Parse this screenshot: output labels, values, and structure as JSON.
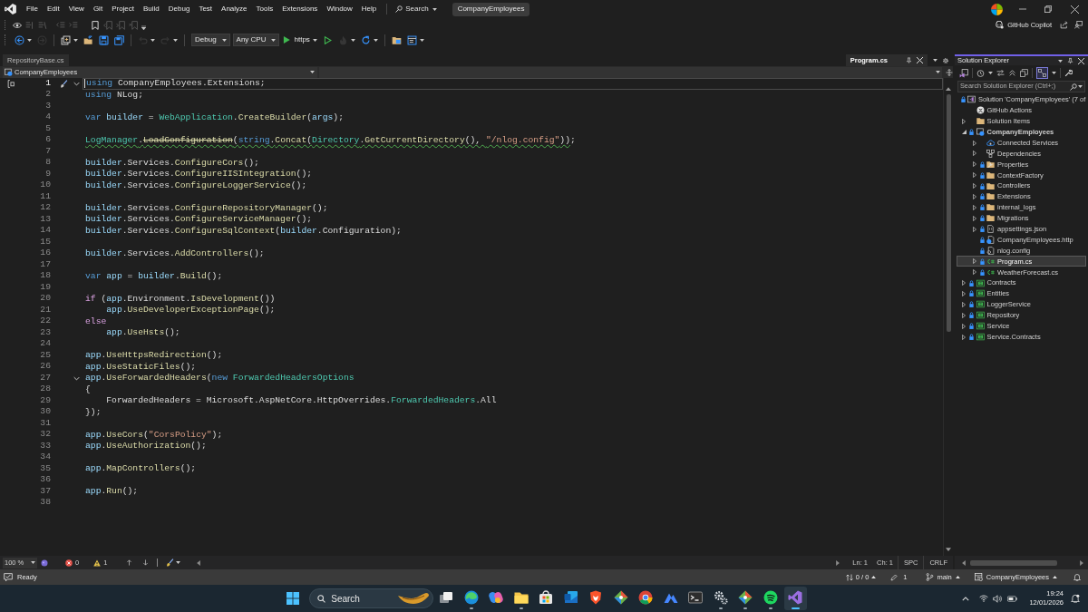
{
  "title_bar": {
    "menu": [
      "File",
      "Edit",
      "View",
      "Git",
      "Project",
      "Build",
      "Debug",
      "Test",
      "Analyze",
      "Tools",
      "Extensions",
      "Window",
      "Help"
    ],
    "search": "Search",
    "solution_name": "CompanyEmployees"
  },
  "edit_toolbar": [
    {
      "kind": "codelens",
      "disabled": false
    },
    {
      "kind": "comment",
      "disabled": true
    },
    {
      "kind": "uncomment",
      "disabled": true
    },
    {
      "kind": "outdent",
      "disabled": true
    },
    {
      "kind": "indent",
      "disabled": true
    },
    {
      "kind": "bookmark",
      "disabled": false
    },
    {
      "kind": "bookmark-prev",
      "disabled": true
    },
    {
      "kind": "bookmark-next",
      "disabled": true
    },
    {
      "kind": "bookmark-clear",
      "disabled": true
    }
  ],
  "copilot": {
    "label": "GitHub Copilot"
  },
  "toolbar": [
    {
      "kind": "back",
      "disabled": false,
      "menu": true
    },
    {
      "kind": "forward",
      "disabled": true,
      "menu": false
    },
    {
      "kind": "separator"
    },
    {
      "kind": "new-item",
      "disabled": false,
      "menu": true
    },
    {
      "kind": "open",
      "disabled": false,
      "menu": false
    },
    {
      "kind": "save",
      "disabled": false,
      "menu": false
    },
    {
      "kind": "save-all",
      "disabled": false,
      "menu": false
    },
    {
      "kind": "separator"
    },
    {
      "kind": "undo",
      "disabled": true,
      "menu": true
    },
    {
      "kind": "redo",
      "disabled": true,
      "menu": true
    },
    {
      "kind": "separator"
    },
    {
      "kind": "dropdown",
      "value": "Debug"
    },
    {
      "kind": "dropdown",
      "value": "Any CPU"
    },
    {
      "kind": "start",
      "label": "https",
      "disabled": false,
      "menu": true
    },
    {
      "kind": "start-outline",
      "disabled": false,
      "menu": false
    },
    {
      "kind": "hot-reload",
      "disabled": true,
      "menu": true
    },
    {
      "kind": "restart",
      "disabled": false,
      "menu": true
    },
    {
      "kind": "separator"
    },
    {
      "kind": "solution-view",
      "disabled": false,
      "menu": false
    },
    {
      "kind": "window-layout",
      "disabled": false,
      "menu": true
    }
  ],
  "editor": {
    "pinned_tabs": [
      {
        "label": "RepositoryBase.cs",
        "selected": false
      }
    ],
    "tabs": [
      {
        "label": "Program.cs",
        "selected": true
      }
    ],
    "navigation": {
      "project": "CompanyEmployees"
    },
    "lines": [
      {
        "number": "1",
        "current": true,
        "foldable": true,
        "tokens": [
          {
            "text": "using",
            "kind": "keyword"
          },
          {
            "text": " CompanyEmployees.Extensions;",
            "kind": "plain"
          }
        ]
      },
      {
        "number": "2",
        "current": false,
        "tokens": [
          {
            "text": "using",
            "kind": "keyword"
          },
          {
            "text": " NLog;",
            "kind": "plain"
          }
        ]
      },
      {
        "number": "3",
        "current": false
      },
      {
        "number": "4",
        "current": false,
        "tokens": [
          {
            "text": "var",
            "kind": "keyword"
          },
          {
            "text": " builder",
            "kind": "variable"
          },
          {
            "text": " = ",
            "kind": "plain"
          },
          {
            "text": "WebApplication",
            "kind": "type"
          },
          {
            "text": ".",
            "kind": "plain"
          },
          {
            "text": "CreateBuilder",
            "kind": "method"
          },
          {
            "text": "(",
            "kind": "plain"
          },
          {
            "text": "args",
            "kind": "variable"
          },
          {
            "text": ");",
            "kind": "plain"
          }
        ]
      },
      {
        "number": "5",
        "current": false
      },
      {
        "number": "6",
        "current": false,
        "tokens": [
          {
            "kind": "warning",
            "tokens": [
              {
                "text": "LogManager",
                "kind": "type"
              },
              {
                "text": ".",
                "kind": "plain"
              },
              {
                "text": "LoadConfiguration",
                "kind": "obsolete"
              },
              {
                "text": "(",
                "kind": "plain"
              },
              {
                "text": "string",
                "kind": "keyword"
              },
              {
                "text": ".",
                "kind": "plain"
              },
              {
                "text": "Concat",
                "kind": "method"
              },
              {
                "text": "(",
                "kind": "plain"
              },
              {
                "text": "Directory",
                "kind": "type"
              },
              {
                "text": ".",
                "kind": "plain"
              },
              {
                "text": "GetCurrentDirectory",
                "kind": "method"
              },
              {
                "text": "(), ",
                "kind": "plain"
              },
              {
                "text": "\"/nlog.config\"",
                "kind": "string"
              },
              {
                "text": "))",
                "kind": "plain"
              }
            ]
          },
          {
            "text": ";",
            "kind": "plain"
          }
        ]
      },
      {
        "number": "7",
        "current": false
      },
      {
        "number": "8",
        "current": false,
        "tokens": [
          {
            "text": "builder",
            "kind": "variable"
          },
          {
            "text": ".Services.",
            "kind": "plain"
          },
          {
            "text": "ConfigureCors",
            "kind": "method"
          },
          {
            "text": "();",
            "kind": "plain"
          }
        ]
      },
      {
        "number": "9",
        "current": false,
        "tokens": [
          {
            "text": "builder",
            "kind": "variable"
          },
          {
            "text": ".Services.",
            "kind": "plain"
          },
          {
            "text": "ConfigureIISIntegration",
            "kind": "method"
          },
          {
            "text": "();",
            "kind": "plain"
          }
        ]
      },
      {
        "number": "10",
        "current": false,
        "tokens": [
          {
            "text": "builder",
            "kind": "variable"
          },
          {
            "text": ".Services.",
            "kind": "plain"
          },
          {
            "text": "ConfigureLoggerService",
            "kind": "method"
          },
          {
            "text": "();",
            "kind": "plain"
          }
        ]
      },
      {
        "number": "11",
        "current": false
      },
      {
        "number": "12",
        "current": false,
        "tokens": [
          {
            "text": "builder",
            "kind": "variable"
          },
          {
            "text": ".Services.",
            "kind": "plain"
          },
          {
            "text": "ConfigureRepositoryManager",
            "kind": "method"
          },
          {
            "text": "();",
            "kind": "plain"
          }
        ]
      },
      {
        "number": "13",
        "current": false,
        "tokens": [
          {
            "text": "builder",
            "kind": "variable"
          },
          {
            "text": ".Services.",
            "kind": "plain"
          },
          {
            "text": "ConfigureServiceManager",
            "kind": "method"
          },
          {
            "text": "();",
            "kind": "plain"
          }
        ]
      },
      {
        "number": "14",
        "current": false,
        "tokens": [
          {
            "text": "builder",
            "kind": "variable"
          },
          {
            "text": ".Services.",
            "kind": "plain"
          },
          {
            "text": "ConfigureSqlContext",
            "kind": "method"
          },
          {
            "text": "(",
            "kind": "plain"
          },
          {
            "text": "builder",
            "kind": "variable"
          },
          {
            "text": ".Configuration);",
            "kind": "plain"
          }
        ]
      },
      {
        "number": "15",
        "current": false
      },
      {
        "number": "16",
        "current": false,
        "tokens": [
          {
            "text": "builder",
            "kind": "variable"
          },
          {
            "text": ".Services.",
            "kind": "plain"
          },
          {
            "text": "AddControllers",
            "kind": "method"
          },
          {
            "text": "();",
            "kind": "plain"
          }
        ]
      },
      {
        "number": "17",
        "current": false
      },
      {
        "number": "18",
        "current": false,
        "tokens": [
          {
            "text": "var",
            "kind": "keyword"
          },
          {
            "text": " app",
            "kind": "variable"
          },
          {
            "text": " = ",
            "kind": "plain"
          },
          {
            "text": "builder",
            "kind": "variable"
          },
          {
            "text": ".",
            "kind": "plain"
          },
          {
            "text": "Build",
            "kind": "method"
          },
          {
            "text": "();",
            "kind": "plain"
          }
        ]
      },
      {
        "number": "19",
        "current": false
      },
      {
        "number": "20",
        "current": false,
        "tokens": [
          {
            "text": "if",
            "kind": "control"
          },
          {
            "text": " (",
            "kind": "plain"
          },
          {
            "text": "app",
            "kind": "variable"
          },
          {
            "text": ".Environment.",
            "kind": "plain"
          },
          {
            "text": "IsDevelopment",
            "kind": "method"
          },
          {
            "text": "())",
            "kind": "plain"
          }
        ]
      },
      {
        "number": "21",
        "current": false,
        "tokens": [
          {
            "text": "    app",
            "kind": "variable"
          },
          {
            "text": ".",
            "kind": "plain"
          },
          {
            "text": "UseDeveloperExceptionPage",
            "kind": "method"
          },
          {
            "text": "();",
            "kind": "plain"
          }
        ]
      },
      {
        "number": "22",
        "current": false,
        "tokens": [
          {
            "text": "else",
            "kind": "control"
          }
        ]
      },
      {
        "number": "23",
        "current": false,
        "tokens": [
          {
            "text": "    app",
            "kind": "variable"
          },
          {
            "text": ".",
            "kind": "plain"
          },
          {
            "text": "UseHsts",
            "kind": "method"
          },
          {
            "text": "();",
            "kind": "plain"
          }
        ]
      },
      {
        "number": "24",
        "current": false
      },
      {
        "number": "25",
        "current": false,
        "tokens": [
          {
            "text": "app",
            "kind": "variable"
          },
          {
            "text": ".",
            "kind": "plain"
          },
          {
            "text": "UseHttpsRedirection",
            "kind": "method"
          },
          {
            "text": "();",
            "kind": "plain"
          }
        ]
      },
      {
        "number": "26",
        "current": false,
        "tokens": [
          {
            "text": "app",
            "kind": "variable"
          },
          {
            "text": ".",
            "kind": "plain"
          },
          {
            "text": "UseStaticFiles",
            "kind": "method"
          },
          {
            "text": "();",
            "kind": "plain"
          }
        ]
      },
      {
        "number": "27",
        "current": false,
        "foldable": true,
        "tokens": [
          {
            "text": "app",
            "kind": "variable"
          },
          {
            "text": ".",
            "kind": "plain"
          },
          {
            "text": "UseForwardedHeaders",
            "kind": "method"
          },
          {
            "text": "(",
            "kind": "plain"
          },
          {
            "text": "new",
            "kind": "keyword"
          },
          {
            "text": " ForwardedHeadersOptions",
            "kind": "type"
          }
        ]
      },
      {
        "number": "28",
        "current": false,
        "tokens": [
          {
            "text": "{",
            "kind": "plain"
          }
        ]
      },
      {
        "number": "29",
        "current": false,
        "tokens": [
          {
            "text": "    ForwardedHeaders = Microsoft.AspNetCore.HttpOverrides.",
            "kind": "plain"
          },
          {
            "text": "ForwardedHeaders",
            "kind": "type"
          },
          {
            "text": ".All",
            "kind": "plain"
          }
        ]
      },
      {
        "number": "30",
        "current": false,
        "tokens": [
          {
            "text": "});",
            "kind": "plain"
          }
        ]
      },
      {
        "number": "31",
        "current": false
      },
      {
        "number": "32",
        "current": false,
        "tokens": [
          {
            "text": "app",
            "kind": "variable"
          },
          {
            "text": ".",
            "kind": "plain"
          },
          {
            "text": "UseCors",
            "kind": "method"
          },
          {
            "text": "(",
            "kind": "plain"
          },
          {
            "text": "\"CorsPolicy\"",
            "kind": "string"
          },
          {
            "text": ");",
            "kind": "plain"
          }
        ]
      },
      {
        "number": "33",
        "current": false,
        "tokens": [
          {
            "text": "app",
            "kind": "variable"
          },
          {
            "text": ".",
            "kind": "plain"
          },
          {
            "text": "UseAuthorization",
            "kind": "method"
          },
          {
            "text": "();",
            "kind": "plain"
          }
        ]
      },
      {
        "number": "34",
        "current": false
      },
      {
        "number": "35",
        "current": false,
        "tokens": [
          {
            "text": "app",
            "kind": "variable"
          },
          {
            "text": ".",
            "kind": "plain"
          },
          {
            "text": "MapControllers",
            "kind": "method"
          },
          {
            "text": "();",
            "kind": "plain"
          }
        ]
      },
      {
        "number": "36",
        "current": false
      },
      {
        "number": "37",
        "current": false,
        "tokens": [
          {
            "text": "app",
            "kind": "variable"
          },
          {
            "text": ".",
            "kind": "plain"
          },
          {
            "text": "Run",
            "kind": "method"
          },
          {
            "text": "();",
            "kind": "plain"
          }
        ]
      },
      {
        "number": "38",
        "current": false
      }
    ],
    "status": {
      "zoom": "100 %",
      "errors": "0",
      "warnings": "1",
      "line": "Ln: 1",
      "column": "Ch: 1",
      "indent": "SPC",
      "line_ending": "CRLF"
    }
  },
  "solution_explorer": {
    "title": "Solution Explorer",
    "track_active": true,
    "search_placeholder": "Search Solution Explorer (Ctrl+;)",
    "tree": [
      {
        "label": "Solution 'CompanyEmployees' (7 of",
        "kind": "solution",
        "locked": true,
        "startup": false,
        "selected": false,
        "children": [
          {
            "label": "GitHub Actions",
            "kind": "github",
            "locked": false,
            "startup": false,
            "selected": false
          },
          {
            "label": "Solution Items",
            "kind": "folder",
            "expanded": false,
            "locked": false,
            "startup": false,
            "selected": false
          },
          {
            "label": "CompanyEmployees",
            "kind": "project",
            "expanded": true,
            "locked": true,
            "startup": true,
            "selected": false,
            "children": [
              {
                "label": "Connected Services",
                "kind": "connected",
                "expanded": false,
                "locked": false,
                "startup": false,
                "selected": false
              },
              {
                "label": "Dependencies",
                "kind": "dependencies",
                "expanded": false,
                "locked": false,
                "startup": false,
                "selected": false
              },
              {
                "label": "Properties",
                "kind": "properties",
                "expanded": false,
                "locked": true,
                "startup": false,
                "selected": false
              },
              {
                "label": "ContextFactory",
                "kind": "folder",
                "expanded": false,
                "locked": true,
                "startup": false,
                "selected": false
              },
              {
                "label": "Controllers",
                "kind": "folder",
                "expanded": false,
                "locked": true,
                "startup": false,
                "selected": false
              },
              {
                "label": "Extensions",
                "kind": "folder",
                "expanded": false,
                "locked": true,
                "startup": false,
                "selected": false
              },
              {
                "label": "internal_logs",
                "kind": "folder",
                "expanded": false,
                "locked": true,
                "startup": false,
                "selected": false
              },
              {
                "label": "Migrations",
                "kind": "folder",
                "expanded": false,
                "locked": true,
                "startup": false,
                "selected": false
              },
              {
                "label": "appsettings.json",
                "kind": "json",
                "expanded": false,
                "locked": true,
                "startup": false,
                "selected": false
              },
              {
                "label": "CompanyEmployees.http",
                "kind": "http",
                "locked": true,
                "startup": false,
                "selected": false
              },
              {
                "label": "nlog.config",
                "kind": "config",
                "locked": true,
                "startup": false,
                "selected": false
              },
              {
                "label": "Program.cs",
                "kind": "csharp",
                "expanded": false,
                "locked": true,
                "startup": false,
                "selected": true
              },
              {
                "label": "WeatherForecast.cs",
                "kind": "csharp",
                "expanded": false,
                "locked": true,
                "startup": false,
                "selected": false
              }
            ]
          },
          {
            "label": "Contracts",
            "kind": "library",
            "expanded": false,
            "locked": true,
            "startup": false,
            "selected": false
          },
          {
            "label": "Entities",
            "kind": "library",
            "expanded": false,
            "locked": true,
            "startup": false,
            "selected": false
          },
          {
            "label": "LoggerService",
            "kind": "library",
            "expanded": false,
            "locked": true,
            "startup": false,
            "selected": false
          },
          {
            "label": "Repository",
            "kind": "library",
            "expanded": false,
            "locked": true,
            "startup": false,
            "selected": false
          },
          {
            "label": "Service",
            "kind": "library",
            "expanded": false,
            "locked": true,
            "startup": false,
            "selected": false
          },
          {
            "label": "Service.Contracts",
            "kind": "library",
            "expanded": false,
            "locked": true,
            "startup": false,
            "selected": false
          }
        ]
      }
    ]
  },
  "status_bar": {
    "message": "Ready",
    "changes": "0 / 0",
    "edits": "1",
    "branch": "main",
    "repository": "CompanyEmployees"
  },
  "taskbar": {
    "search": "Search",
    "apps": [
      {
        "kind": "task-view",
        "running": false,
        "selected": false
      },
      {
        "kind": "swirl-browser",
        "running": true,
        "selected": false
      },
      {
        "kind": "assistant",
        "running": false,
        "selected": false
      },
      {
        "kind": "file-manager",
        "running": true,
        "selected": false
      },
      {
        "kind": "store",
        "running": false,
        "selected": false
      },
      {
        "kind": "mail",
        "running": false,
        "selected": false
      },
      {
        "kind": "shield-browser",
        "running": false,
        "selected": false
      },
      {
        "kind": "diamond",
        "running": false,
        "selected": false
      },
      {
        "kind": "circle-browser",
        "running": false,
        "selected": false
      },
      {
        "kind": "mountain",
        "running": false,
        "selected": false
      },
      {
        "kind": "terminal",
        "running": false,
        "selected": false
      },
      {
        "kind": "gears",
        "running": true,
        "selected": false
      },
      {
        "kind": "diamond",
        "running": true,
        "selected": false
      },
      {
        "kind": "music",
        "running": true,
        "selected": false
      },
      {
        "kind": "ribbon",
        "running": true,
        "selected": true
      }
    ],
    "time": "19:24",
    "date": "12/01/2026"
  }
}
